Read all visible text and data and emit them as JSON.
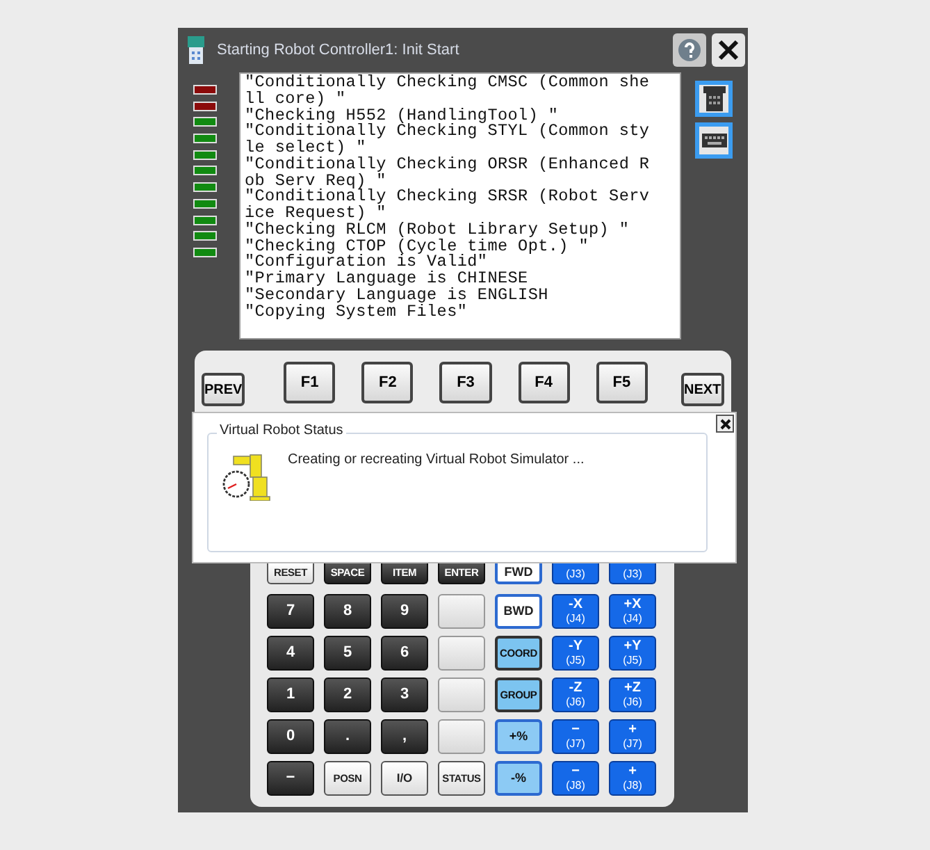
{
  "window": {
    "title": "Starting Robot Controller1: Init Start"
  },
  "indicators": [
    {
      "color": "#8b0a0a"
    },
    {
      "color": "#8b0a0a"
    },
    {
      "color": "#118a11"
    },
    {
      "color": "#118a11"
    },
    {
      "color": "#118a11"
    },
    {
      "color": "#118a11"
    },
    {
      "color": "#118a11"
    },
    {
      "color": "#118a11"
    },
    {
      "color": "#118a11"
    },
    {
      "color": "#118a11"
    },
    {
      "color": "#118a11"
    }
  ],
  "log": {
    "lines": [
      "\"Conditionally Checking CMSC (Common she",
      "ll core) \"",
      "\"Checking H552 (HandlingTool) \"",
      "\"Conditionally Checking STYL (Common sty",
      "le select) \"",
      "\"Conditionally Checking ORSR (Enhanced R",
      "ob Serv Req) \"",
      "\"Conditionally Checking SRSR (Robot Serv",
      "ice Request) \"",
      "\"Checking RLCM (Robot Library Setup) \"",
      "\"Checking CTOP (Cycle time Opt.) \"",
      "\"Configuration is Valid\"",
      "\"Primary Language is CHINESE",
      "\"Secondary Language is ENGLISH",
      "\"Copying System Files\""
    ]
  },
  "function_keys": {
    "prev": "PREV",
    "keys": [
      "F1",
      "F2",
      "F3",
      "F4",
      "F5"
    ],
    "next": "NEXT"
  },
  "status_dialog": {
    "group_title": "Virtual Robot Status",
    "message": "Creating or recreating Virtual Robot Simulator ..."
  },
  "keypad": {
    "rows": [
      [
        {
          "kind": "light",
          "label": "RESET"
        },
        {
          "kind": "dark",
          "label": "SPACE"
        },
        {
          "kind": "dark",
          "label": "ITEM"
        },
        {
          "kind": "dark",
          "label": "ENTER"
        },
        {
          "kind": "nav",
          "label": "FWD"
        },
        {
          "kind": "jog",
          "sub": "(J3)"
        },
        {
          "kind": "jog",
          "sub": "(J3)"
        }
      ],
      [
        {
          "kind": "dark",
          "label": "7"
        },
        {
          "kind": "dark",
          "label": "8"
        },
        {
          "kind": "dark",
          "label": "9"
        },
        {
          "kind": "blank"
        },
        {
          "kind": "nav",
          "label": "BWD"
        },
        {
          "kind": "jog",
          "label": "-X",
          "sub": "(J4)"
        },
        {
          "kind": "jog",
          "label": "+X",
          "sub": "(J4)"
        }
      ],
      [
        {
          "kind": "dark",
          "label": "4"
        },
        {
          "kind": "dark",
          "label": "5"
        },
        {
          "kind": "dark",
          "label": "6"
        },
        {
          "kind": "blank"
        },
        {
          "kind": "mode",
          "label": "COORD"
        },
        {
          "kind": "jog",
          "label": "-Y",
          "sub": "(J5)"
        },
        {
          "kind": "jog",
          "label": "+Y",
          "sub": "(J5)"
        }
      ],
      [
        {
          "kind": "dark",
          "label": "1"
        },
        {
          "kind": "dark",
          "label": "2"
        },
        {
          "kind": "dark",
          "label": "3"
        },
        {
          "kind": "blank"
        },
        {
          "kind": "mode",
          "label": "GROUP"
        },
        {
          "kind": "jog",
          "label": "-Z",
          "sub": "(J6)"
        },
        {
          "kind": "jog",
          "label": "+Z",
          "sub": "(J6)"
        }
      ],
      [
        {
          "kind": "dark",
          "label": "0"
        },
        {
          "kind": "dark",
          "label": "."
        },
        {
          "kind": "dark",
          "label": ","
        },
        {
          "kind": "blank"
        },
        {
          "kind": "speed",
          "label": "+%"
        },
        {
          "kind": "jog",
          "label": "−",
          "sub": "(J7)"
        },
        {
          "kind": "jog",
          "label": "+",
          "sub": "(J7)"
        }
      ],
      [
        {
          "kind": "dark",
          "label": "−"
        },
        {
          "kind": "light",
          "label": "POSN"
        },
        {
          "kind": "light",
          "label": "I/O"
        },
        {
          "kind": "light",
          "label": "STATUS"
        },
        {
          "kind": "speed",
          "label": "-%"
        },
        {
          "kind": "jog",
          "label": "−",
          "sub": "(J8)"
        },
        {
          "kind": "jog",
          "label": "+",
          "sub": "(J8)"
        }
      ]
    ]
  }
}
